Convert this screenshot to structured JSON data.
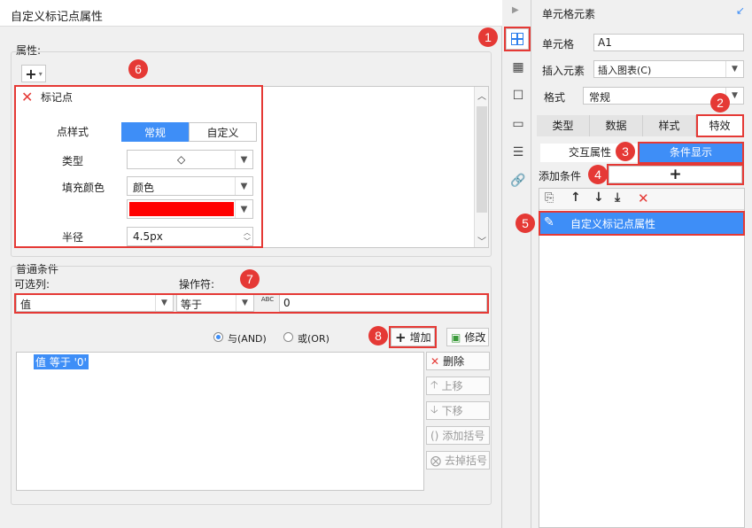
{
  "dialog": {
    "title": "自定义标记点属性",
    "section_attr": "属性:",
    "add_symbol": "+",
    "add_caret": "▾"
  },
  "marker": {
    "header": "标记点",
    "style_label": "点样式",
    "style_opt1": "常规",
    "style_opt2": "自定义",
    "type_label": "类型",
    "type_value": "◇",
    "fill_label": "填充颜色",
    "fill_value": "颜色",
    "fill_color": "#ff0000",
    "radius_label": "半径",
    "radius_value": "4.5px"
  },
  "cond": {
    "section": "普通条件",
    "col_label": "可选列:",
    "op_label": "操作符:",
    "col_value": "值",
    "op_value": "等于",
    "abc_label": "ABC",
    "value": "0",
    "and_label": "与(AND)",
    "or_label": "或(OR)",
    "add_btn": "增加",
    "modify_btn": "修改",
    "list_item": "值 等于 '0'",
    "delete_btn": "删除",
    "up_btn": "上移",
    "down_btn": "下移",
    "addparen_btn": "添加括号",
    "removeparen_btn": "去掉括号"
  },
  "right": {
    "title": "单元格元素",
    "cell_label": "单元格",
    "cell_value": "A1",
    "insert_label": "插入元素",
    "insert_value": "插入图表(C)",
    "format_label": "格式",
    "format_value": "常规",
    "tabs": [
      "类型",
      "数据",
      "样式",
      "特效"
    ],
    "sub_interact": "交互属性",
    "sub_cond": "条件显示",
    "add_cond_label": "添加条件",
    "add_symbol": "+",
    "list_item": "自定义标记点属性"
  },
  "badges": [
    "1",
    "2",
    "3",
    "4",
    "5",
    "6",
    "7",
    "8"
  ],
  "colors": {
    "accent": "#3e8ef7",
    "badge": "#e53935",
    "fill_red": "#ff0000"
  }
}
